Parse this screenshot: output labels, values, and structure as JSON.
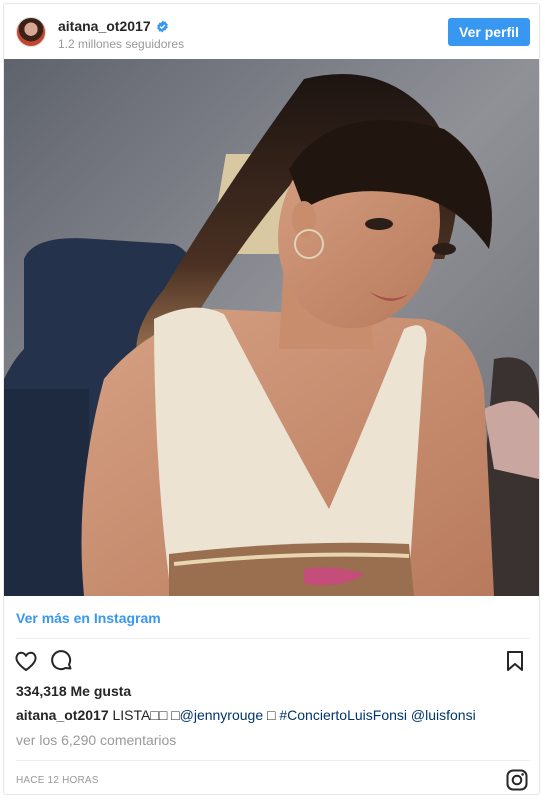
{
  "header": {
    "username": "aitana_ot2017",
    "followers": "1.2 millones seguidores",
    "follow_button": "Ver perfil"
  },
  "post": {
    "view_more": "Ver más en Instagram",
    "likes": "334,318 Me gusta",
    "caption_user": "aitana_ot2017",
    "caption_text": "LISTA□□ □",
    "caption_mention1": "@jennyrouge",
    "caption_mid": " □ ",
    "caption_hashtag": "#ConciertoLuisFonsi",
    "caption_mention2": "@luisfonsi",
    "comments_link": "ver los 6,290 comentarios",
    "timestamp": "HACE 12 HORAS"
  },
  "icons": {
    "like": "heart-icon",
    "comment": "comment-icon",
    "save": "bookmark-icon",
    "brand": "instagram-icon",
    "verified": "verified-badge-icon"
  },
  "colors": {
    "accent": "#3897f0",
    "text": "#262626",
    "muted": "#999999"
  }
}
